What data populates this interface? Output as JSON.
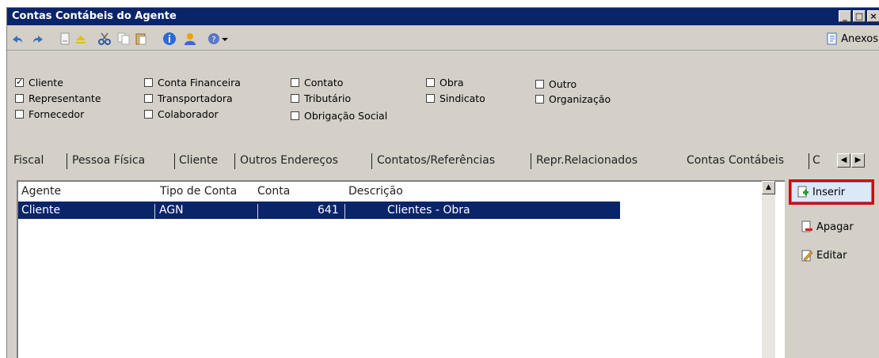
{
  "window": {
    "title": "Contas Contábeis do Agente",
    "controls": [
      "_",
      "□",
      "×"
    ]
  },
  "toolbar": {
    "icons": [
      "undo-icon",
      "redo-icon",
      "new-document-icon",
      "eject-icon",
      "cut-icon",
      "copy-icon",
      "paste-icon",
      "info-icon",
      "user-icon",
      "help-icon",
      "dropdown-arrow-icon"
    ],
    "anexos_label": "Anexos"
  },
  "agent_types": [
    {
      "label": "Cliente",
      "checked": true
    },
    {
      "label": "Representante",
      "checked": false
    },
    {
      "label": "Fornecedor",
      "checked": false
    },
    {
      "label": "Conta Financeira",
      "checked": false
    },
    {
      "label": "Transportadora",
      "checked": false
    },
    {
      "label": "Colaborador",
      "checked": false
    },
    {
      "label": "Contato",
      "checked": false
    },
    {
      "label": "Tributário",
      "checked": false
    },
    {
      "label": "Obrigação Social",
      "checked": false
    },
    {
      "label": "Obra",
      "checked": false
    },
    {
      "label": "Sindicato",
      "checked": false
    },
    {
      "label": "Outro",
      "checked": false
    },
    {
      "label": "Organização",
      "checked": false
    }
  ],
  "tabs": [
    {
      "label": "Fiscal"
    },
    {
      "label": "Pessoa Física"
    },
    {
      "label": "Cliente"
    },
    {
      "label": "Outros Endereços"
    },
    {
      "label": "Contatos/Referências"
    },
    {
      "label": "Repr.Relacionados"
    },
    {
      "label": "Contas Contábeis",
      "active": true
    },
    {
      "label": "C"
    }
  ],
  "grid": {
    "columns": [
      "Agente",
      "Tipo de Conta",
      "Conta",
      "Descrição"
    ],
    "rows": [
      {
        "agente": "Cliente",
        "tipo": "AGN",
        "conta": "641",
        "descricao": "Clientes - Obra"
      }
    ]
  },
  "actions": {
    "inserir": "Inserir",
    "apagar": "Apagar",
    "editar": "Editar"
  },
  "colors": {
    "titlebar": "#0a246a",
    "selection": "#0a246a",
    "highlight_border": "#d40000",
    "panel": "#d4d0c8"
  }
}
